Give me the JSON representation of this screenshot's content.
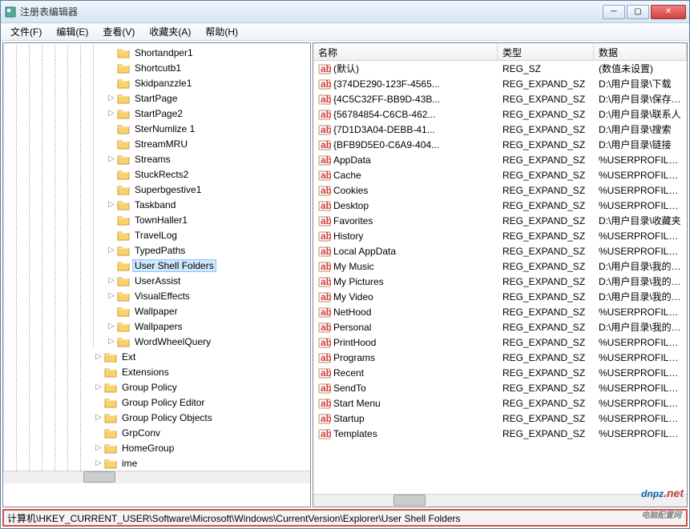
{
  "window": {
    "title": "注册表编辑器"
  },
  "menu": [
    "文件(F)",
    "编辑(E)",
    "查看(V)",
    "收藏夹(A)",
    "帮助(H)"
  ],
  "tree": [
    {
      "d": 8,
      "e": "",
      "n": "Shortandper1"
    },
    {
      "d": 8,
      "e": "",
      "n": "Shortcutb1"
    },
    {
      "d": 8,
      "e": "",
      "n": "Skidpanzzle1"
    },
    {
      "d": 8,
      "e": "▷",
      "n": "StartPage"
    },
    {
      "d": 8,
      "e": "▷",
      "n": "StartPage2"
    },
    {
      "d": 8,
      "e": "",
      "n": "SterNumlize 1"
    },
    {
      "d": 8,
      "e": "",
      "n": "StreamMRU"
    },
    {
      "d": 8,
      "e": "▷",
      "n": "Streams"
    },
    {
      "d": 8,
      "e": "",
      "n": "StuckRects2"
    },
    {
      "d": 8,
      "e": "",
      "n": "Superbgestive1"
    },
    {
      "d": 8,
      "e": "▷",
      "n": "Taskband"
    },
    {
      "d": 8,
      "e": "",
      "n": "TownHaller1"
    },
    {
      "d": 8,
      "e": "",
      "n": "TravelLog"
    },
    {
      "d": 8,
      "e": "▷",
      "n": "TypedPaths"
    },
    {
      "d": 8,
      "e": "",
      "n": "User Shell Folders",
      "sel": true
    },
    {
      "d": 8,
      "e": "▷",
      "n": "UserAssist"
    },
    {
      "d": 8,
      "e": "▷",
      "n": "VisualEffects"
    },
    {
      "d": 8,
      "e": "",
      "n": "Wallpaper"
    },
    {
      "d": 8,
      "e": "▷",
      "n": "Wallpapers"
    },
    {
      "d": 8,
      "e": "▷",
      "n": "WordWheelQuery"
    },
    {
      "d": 7,
      "e": "▷",
      "n": "Ext"
    },
    {
      "d": 7,
      "e": "",
      "n": "Extensions"
    },
    {
      "d": 7,
      "e": "▷",
      "n": "Group Policy"
    },
    {
      "d": 7,
      "e": "",
      "n": "Group Policy Editor"
    },
    {
      "d": 7,
      "e": "▷",
      "n": "Group Policy Objects"
    },
    {
      "d": 7,
      "e": "",
      "n": "GrpConv"
    },
    {
      "d": 7,
      "e": "▷",
      "n": "HomeGroup"
    },
    {
      "d": 7,
      "e": "▷",
      "n": "ime"
    }
  ],
  "columns": {
    "name": "名称",
    "type": "类型",
    "data": "数据"
  },
  "values": [
    {
      "n": "(默认)",
      "t": "REG_SZ",
      "d": "(数值未设置)"
    },
    {
      "n": "{374DE290-123F-4565...",
      "t": "REG_EXPAND_SZ",
      "d": "D:\\用户目录\\下载"
    },
    {
      "n": "{4C5C32FF-BB9D-43B...",
      "t": "REG_EXPAND_SZ",
      "d": "D:\\用户目录\\保存的游戏"
    },
    {
      "n": "{56784854-C6CB-462...",
      "t": "REG_EXPAND_SZ",
      "d": "D:\\用户目录\\联系人"
    },
    {
      "n": "{7D1D3A04-DEBB-41...",
      "t": "REG_EXPAND_SZ",
      "d": "D:\\用户目录\\搜索"
    },
    {
      "n": "{BFB9D5E0-C6A9-404...",
      "t": "REG_EXPAND_SZ",
      "d": "D:\\用户目录\\链接"
    },
    {
      "n": "AppData",
      "t": "REG_EXPAND_SZ",
      "d": "%USERPROFILE%\\AppData\\Ro"
    },
    {
      "n": "Cache",
      "t": "REG_EXPAND_SZ",
      "d": "%USERPROFILE%\\AppData\\Lo"
    },
    {
      "n": "Cookies",
      "t": "REG_EXPAND_SZ",
      "d": "%USERPROFILE%\\AppData\\Ro"
    },
    {
      "n": "Desktop",
      "t": "REG_EXPAND_SZ",
      "d": "%USERPROFILE%\\Desktop"
    },
    {
      "n": "Favorites",
      "t": "REG_EXPAND_SZ",
      "d": "D:\\用户目录\\收藏夹"
    },
    {
      "n": "History",
      "t": "REG_EXPAND_SZ",
      "d": "%USERPROFILE%\\AppData\\Lo"
    },
    {
      "n": "Local AppData",
      "t": "REG_EXPAND_SZ",
      "d": "%USERPROFILE%\\AppData\\Lo"
    },
    {
      "n": "My Music",
      "t": "REG_EXPAND_SZ",
      "d": "D:\\用户目录\\我的音乐"
    },
    {
      "n": "My Pictures",
      "t": "REG_EXPAND_SZ",
      "d": "D:\\用户目录\\我的图片"
    },
    {
      "n": "My Video",
      "t": "REG_EXPAND_SZ",
      "d": "D:\\用户目录\\我的视频"
    },
    {
      "n": "NetHood",
      "t": "REG_EXPAND_SZ",
      "d": "%USERPROFILE%\\AppData\\Ro"
    },
    {
      "n": "Personal",
      "t": "REG_EXPAND_SZ",
      "d": "D:\\用户目录\\我的文档"
    },
    {
      "n": "PrintHood",
      "t": "REG_EXPAND_SZ",
      "d": "%USERPROFILE%\\AppData\\Ro"
    },
    {
      "n": "Programs",
      "t": "REG_EXPAND_SZ",
      "d": "%USERPROFILE%\\AppData\\Ro"
    },
    {
      "n": "Recent",
      "t": "REG_EXPAND_SZ",
      "d": "%USERPROFILE%\\AppData\\Ro"
    },
    {
      "n": "SendTo",
      "t": "REG_EXPAND_SZ",
      "d": "%USERPROFILE%\\AppData\\Ro"
    },
    {
      "n": "Start Menu",
      "t": "REG_EXPAND_SZ",
      "d": "%USERPROFILE%\\AppData\\Ro"
    },
    {
      "n": "Startup",
      "t": "REG_EXPAND_SZ",
      "d": "%USERPROFILE%\\AppData\\Ro"
    },
    {
      "n": "Templates",
      "t": "REG_EXPAND_SZ",
      "d": "%USERPROFILE%\\AppData\\Ro"
    }
  ],
  "statusbar": "计算机\\HKEY_CURRENT_USER\\Software\\Microsoft\\Windows\\CurrentVersion\\Explorer\\User Shell Folders",
  "watermark": {
    "main": "dnpz",
    "sub": ".net"
  }
}
